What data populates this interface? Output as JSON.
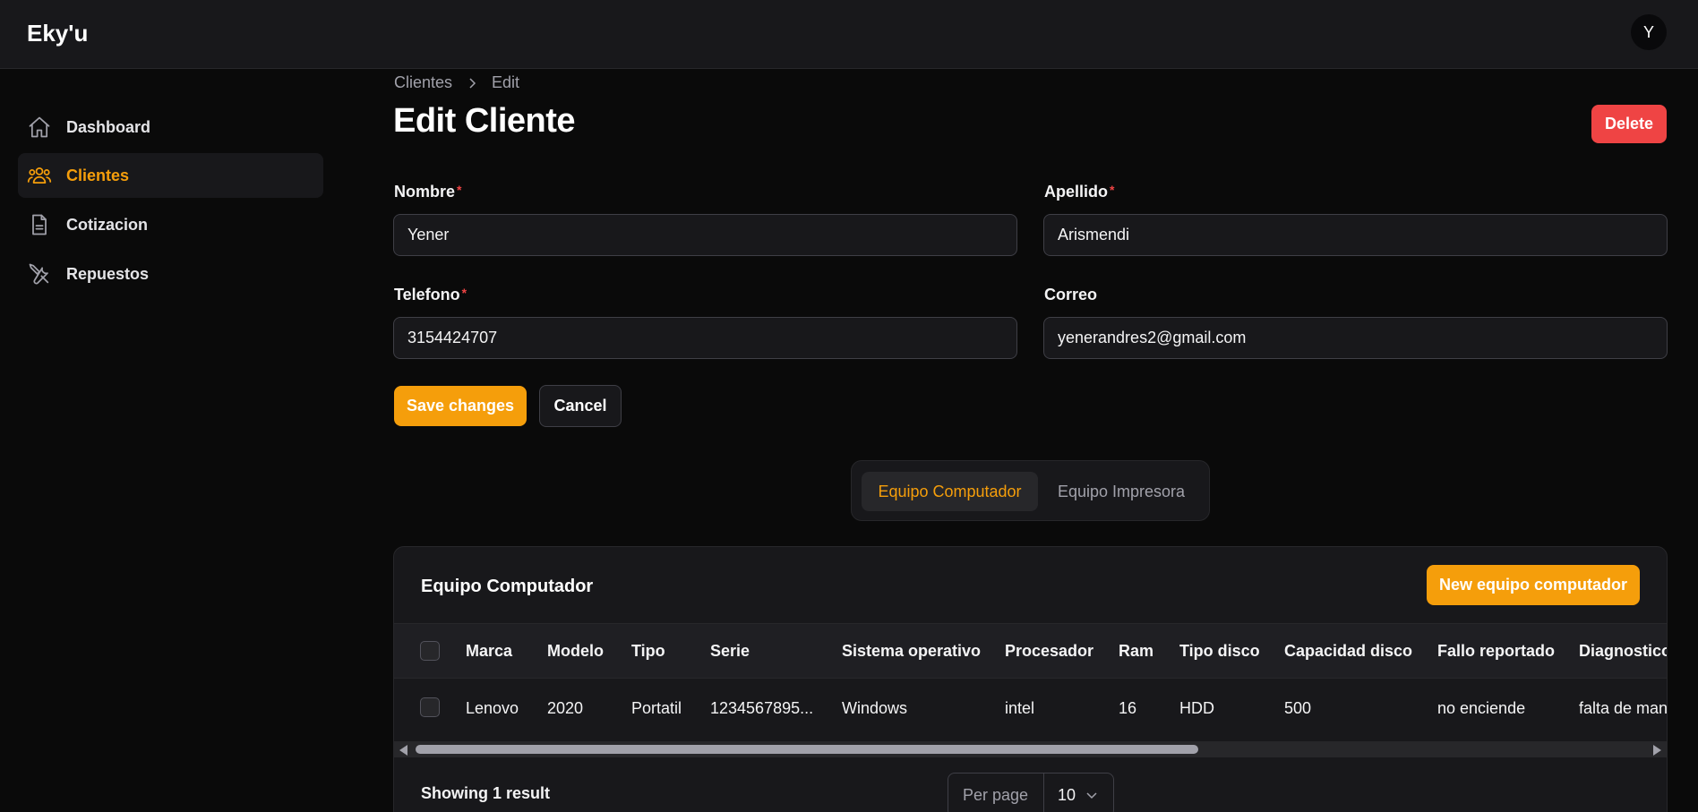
{
  "app": {
    "brand": "Eky'u",
    "avatar_initial": "Y"
  },
  "sidebar": {
    "items": [
      {
        "label": "Dashboard",
        "icon": "home-icon",
        "active": false
      },
      {
        "label": "Clientes",
        "icon": "users-icon",
        "active": true
      },
      {
        "label": "Cotizacion",
        "icon": "document-icon",
        "active": false
      },
      {
        "label": "Repuestos",
        "icon": "tools-icon",
        "active": false
      }
    ]
  },
  "breadcrumb": {
    "parent": "Clientes",
    "current": "Edit"
  },
  "page": {
    "title": "Edit Cliente",
    "delete_label": "Delete"
  },
  "form": {
    "nombre": {
      "label": "Nombre",
      "required": "*",
      "value": "Yener"
    },
    "apellido": {
      "label": "Apellido",
      "required": "*",
      "value": "Arismendi"
    },
    "telefono": {
      "label": "Telefono",
      "required": "*",
      "value": "3154424707"
    },
    "correo": {
      "label": "Correo",
      "value": "yenerandres2@gmail.com"
    },
    "save_label": "Save changes",
    "cancel_label": "Cancel"
  },
  "tabs": [
    {
      "label": "Equipo Computador",
      "active": true
    },
    {
      "label": "Equipo Impresora",
      "active": false
    }
  ],
  "table": {
    "title": "Equipo Computador",
    "new_label": "New equipo computador",
    "columns": [
      "Marca",
      "Modelo",
      "Tipo",
      "Serie",
      "Sistema operativo",
      "Procesador",
      "Ram",
      "Tipo disco",
      "Capacidad disco",
      "Fallo reportado",
      "Diagnostico"
    ],
    "rows": [
      [
        "Lenovo",
        "2020",
        "Portatil",
        "1234567895...",
        "Windows",
        "intel",
        "16",
        "HDD",
        "500",
        "no enciende",
        "falta de man"
      ]
    ],
    "showing": "Showing 1 result",
    "per_page_label": "Per page",
    "per_page_value": "10"
  },
  "colors": {
    "accent": "#f59e0b",
    "danger": "#ef4444",
    "background": "#0a0a0a",
    "surface": "#18181b"
  }
}
